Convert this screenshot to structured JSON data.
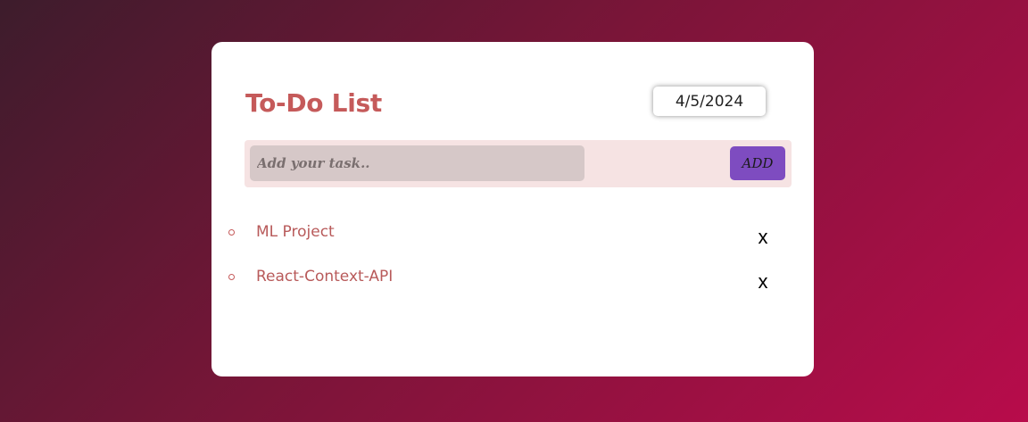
{
  "app": {
    "title": "To-Do List",
    "date": "4/5/2024"
  },
  "add_bar": {
    "placeholder": "Add your task..",
    "value": "",
    "button_label": "ADD"
  },
  "tasks": [
    {
      "text": "ML Project",
      "delete_label": "x"
    },
    {
      "text": "React-Context-API",
      "delete_label": "x"
    }
  ],
  "colors": {
    "accent": "#c55a5a",
    "add_button": "#7e4cc0",
    "input_bg": "#d6c8c8",
    "bar_bg": "#f6e3e3"
  }
}
